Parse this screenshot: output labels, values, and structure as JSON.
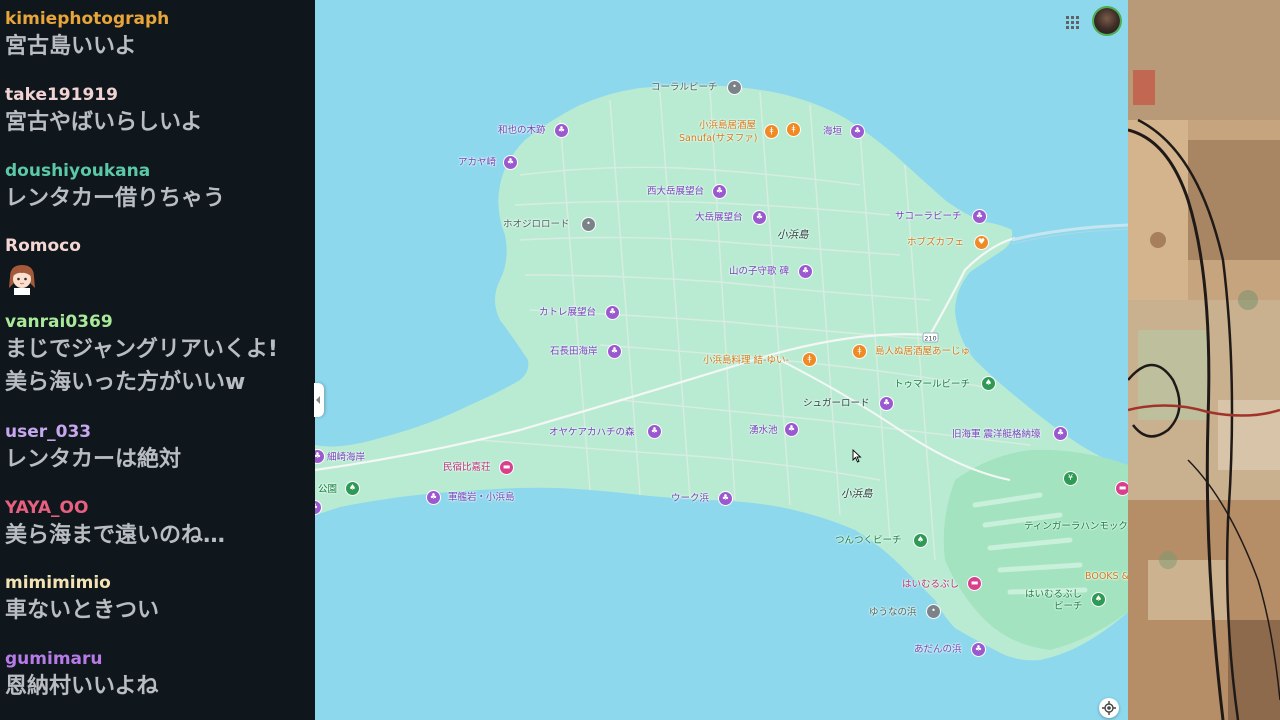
{
  "chat": {
    "messages": [
      {
        "user": "kimiephotograph",
        "text": "宮古島いいよ",
        "color": "#e8a53a"
      },
      {
        "user": "take191919",
        "text": "宮古やばいらしいよ",
        "color": "#f2d3d3"
      },
      {
        "user": "doushiyoukana",
        "text": "レンタカー借りちゃう",
        "color": "#5bc8a8"
      },
      {
        "user": "Romoco",
        "text": "",
        "color": "#f4d6d2",
        "emote": "girl-face-emote"
      },
      {
        "user": "vanrai0369",
        "text": "まじでジャングリアいくよ!",
        "text2": "美ら海いった方がいいw",
        "color": "#a9ea9a"
      },
      {
        "user": "user_033",
        "text": "レンタカーは絶対",
        "color": "#c7a7ef"
      },
      {
        "user": "YAYA_OO",
        "text": "美ら海まで遠いのね…",
        "color": "#e8607f"
      },
      {
        "user": "mimimimio",
        "text": "車ないときつい",
        "color": "#f3e2b4"
      },
      {
        "user": "gumimaru",
        "text": "恩納村いいよね",
        "color": "#b67be6"
      }
    ]
  },
  "map": {
    "island_name": "小浜島",
    "island_name_2": "小浜島",
    "route_shield": "210",
    "places": [
      {
        "name": "コーラルビーチ",
        "kind": "gray"
      },
      {
        "name": "和也の木跡",
        "kind": "purple"
      },
      {
        "name": "小浜島居酒屋",
        "kind": "orange"
      },
      {
        "name": "Sanufa(サヌファ)",
        "kind": "orange"
      },
      {
        "name": "海垣",
        "kind": "purple"
      },
      {
        "name": "アカヤ崎",
        "kind": "purple"
      },
      {
        "name": "西大岳展望台",
        "kind": "purple"
      },
      {
        "name": "大岳展望台",
        "kind": "purple"
      },
      {
        "name": "ホオジロロード",
        "kind": "gray"
      },
      {
        "name": "サコーラビーチ",
        "kind": "purple"
      },
      {
        "name": "ホブズカフェ",
        "kind": "orange"
      },
      {
        "name": "山の子守歌 碑",
        "kind": "purple"
      },
      {
        "name": "カトレ展望台",
        "kind": "purple"
      },
      {
        "name": "石長田海岸",
        "kind": "purple"
      },
      {
        "name": "小浜島料理 結-ゆい-",
        "kind": "orange"
      },
      {
        "name": "島人ぬ居酒屋あーじゅ",
        "kind": "orange"
      },
      {
        "name": "トゥマールビーチ",
        "kind": "green"
      },
      {
        "name": "シュガーロード",
        "kind": "purple"
      },
      {
        "name": "オヤケアカハチの森",
        "kind": "purple"
      },
      {
        "name": "湧水池",
        "kind": "purple"
      },
      {
        "name": "旧海軍 震洋艇格納壕",
        "kind": "purple"
      },
      {
        "name": "細崎海岸",
        "kind": "purple"
      },
      {
        "name": "民宿比嘉荘",
        "kind": "pink"
      },
      {
        "name": "公園",
        "kind": "green"
      },
      {
        "name": "軍艦岩・小浜島",
        "kind": "purple"
      },
      {
        "name": "ウーク浜",
        "kind": "purple"
      },
      {
        "name": "ティンガーラハンモック",
        "kind": "green"
      },
      {
        "name": "つんつくビーチ",
        "kind": "green"
      },
      {
        "name": "BOOKS &",
        "kind": "orange"
      },
      {
        "name": "はいむるぶし",
        "kind": "pink"
      },
      {
        "name": "はいむるぶし",
        "kind": "green"
      },
      {
        "name": "ビーチ",
        "kind": "green"
      },
      {
        "name": "ゆうなの浜",
        "kind": "gray"
      },
      {
        "name": "あだんの浜",
        "kind": "purple"
      }
    ],
    "colors": {
      "sea": "#8ed8ee",
      "land": "#b9ebd3",
      "road": "#d7e7dd",
      "poi_purple": "#9b59d0",
      "poi_orange": "#ef8a25"
    }
  },
  "toolbar": {
    "apps_icon": "apps-grid-icon",
    "account_icon": "account-avatar",
    "locate_icon": "my-location-icon"
  }
}
